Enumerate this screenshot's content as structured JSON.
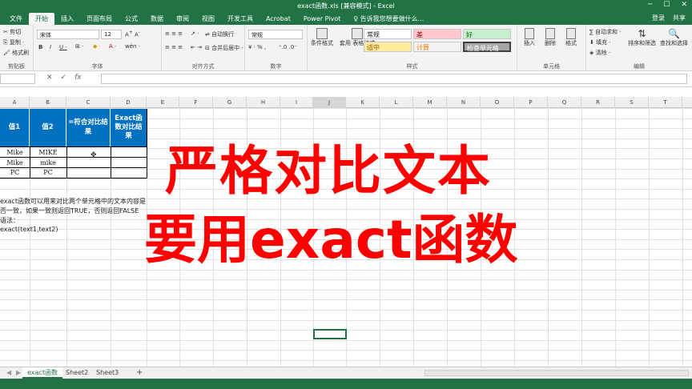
{
  "window": {
    "title": "exact函数.xls  [兼容模式] - Excel",
    "login": "登录",
    "share": "共享"
  },
  "ribbon_tabs": [
    "文件",
    "开始",
    "插入",
    "页面布局",
    "公式",
    "数据",
    "审阅",
    "视图",
    "开发工具",
    "Acrobat",
    "Power Pivot",
    "♀ 告诉我您想要做什么..."
  ],
  "clipboard": {
    "cut": "剪切",
    "copy": "复制 ·",
    "format_painter": "格式刷",
    "label": "剪贴板"
  },
  "font": {
    "name": "宋体",
    "size": "12",
    "label": "字体"
  },
  "alignment": {
    "wrap": "自动换行",
    "merge": "合并后居中 ·",
    "label": "对齐方式"
  },
  "number": {
    "format": "常规",
    "label": "数字"
  },
  "styles": {
    "conditional": "条件格式",
    "table": "套用\n表格格式",
    "normal": "常规",
    "bad": "差",
    "good": "好",
    "neutral": "适中",
    "calc": "计算",
    "check": "检查单元格",
    "label": "样式"
  },
  "cells_group": {
    "insert": "插入",
    "delete": "删除",
    "format": "格式",
    "label": "单元格"
  },
  "editing": {
    "autosum": "∑ 自动求和 ·",
    "fill": "填充 ·",
    "clear": "清除 ·",
    "sort": "排序和筛选",
    "find": "查找和选择",
    "label": "编辑"
  },
  "formula_bar": {
    "cancel": "✕",
    "confirm": "✓",
    "fx": "fx"
  },
  "columns": [
    "A",
    "B",
    "C",
    "D",
    "E",
    "F",
    "G",
    "H",
    "I",
    "J",
    "K",
    "L",
    "M",
    "N",
    "O",
    "P",
    "Q",
    "R",
    "S",
    "T"
  ],
  "selected_column": "J",
  "table": {
    "headers": [
      "值1",
      "值2",
      "=符合对比结果",
      "Exact函数对比结果"
    ],
    "rows": [
      [
        "Mike",
        "MIKE",
        "",
        ""
      ],
      [
        "Mike",
        "mike",
        "",
        ""
      ],
      [
        "PC",
        "PC",
        "",
        ""
      ]
    ]
  },
  "notes": [
    "exact函数可以用来对比两个单元格中的文本内容是",
    "否一致，如果一致则返回TRUE，否则返回FALSE",
    "语法：",
    "exact(text1,text2)"
  ],
  "overlay": {
    "line1": "严格对比文本",
    "line2": "要用exact函数"
  },
  "sheets": [
    "exact函数",
    "Sheet2",
    "Sheet3"
  ],
  "add_sheet": "+",
  "colors": {
    "excel_green": "#217346",
    "header_blue": "#0070c0",
    "overlay_red": "#ff0000"
  }
}
